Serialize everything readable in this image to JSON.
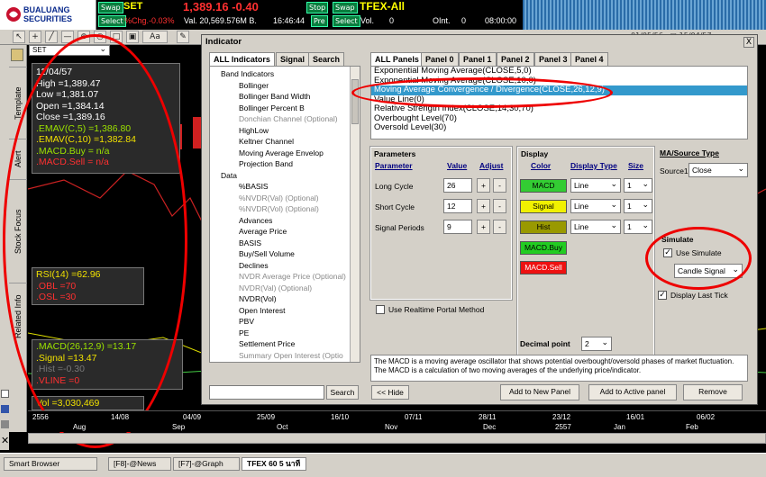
{
  "ticker": {
    "logo_line1": "BUALUANG",
    "logo_line2": "SECURITIES",
    "row1": {
      "swap": "Swap",
      "symbol": "SET",
      "price": "1,389.16 -0.40",
      "stop": "Stop",
      "swap2": "Swap",
      "tfex": "TFEX-All"
    },
    "row2": {
      "select": "Select",
      "chg": "%Chg.-0.03%",
      "val": "Val. 20,569.576M B.",
      "time": "16:46:44",
      "pre": "Pre",
      "select2": "Select",
      "vol": "Vol.",
      "vol_val": "0",
      "oint": "OInt.",
      "oint_val": "0",
      "time2": "08:00:00"
    }
  },
  "vtabs": [
    "Template",
    "Alert",
    "Stock Focus",
    "Related Info"
  ],
  "symbol_select": "SET",
  "info_panel": {
    "date": "11/04/57",
    "high": "High  =1,389.47",
    "low": "Low  =1,381.07",
    "open": "Open  =1,384.14",
    "close": "Close  =1,389.16",
    "emav5": ".EMAV(C,5)    =1,386.80",
    "emav10": ".EMAV(C,10)  =1,382.84",
    "macdbuy": ".MACD.Buy  = n/a",
    "macdsell": ".MACD.Sell  = n/a"
  },
  "rsi_panel": {
    "rsi": "RSI(14)   =62.96",
    "obl": ".OBL    =70",
    "osl": ".OSL    =30"
  },
  "macd_panel": {
    "macd": ".MACD(26,12,9)   =13.17",
    "signal": ".Signal  =13.47",
    "hist": ".Hist  =-0.30",
    "vline": ".VLINE   =0"
  },
  "vol_panel": {
    "vol": "Vol   =3,030,469"
  },
  "time_axis": {
    "row1": [
      "2556",
      "14/08",
      "04/09",
      "25/09",
      "16/10",
      "07/11",
      "28/11",
      "23/12",
      "16/01",
      "06/02"
    ],
    "row2": [
      "Aug",
      "Sep",
      "Oct",
      "Nov",
      "Dec",
      "2557",
      "Jan",
      "Feb"
    ]
  },
  "dialog": {
    "title": "Indicator",
    "left_tabs": [
      "ALL Indicators",
      "Signal",
      "Search"
    ],
    "tree": [
      {
        "label": "Band Indicators",
        "level": 0,
        "dim": false
      },
      {
        "label": "Bollinger",
        "level": 1,
        "dim": false
      },
      {
        "label": "Bollinger Band Width",
        "level": 1,
        "dim": false
      },
      {
        "label": "Bollinger Percent B",
        "level": 1,
        "dim": false
      },
      {
        "label": "Donchian Channel (Optional)",
        "level": 1,
        "dim": true
      },
      {
        "label": "HighLow",
        "level": 1,
        "dim": false
      },
      {
        "label": "Keltner Channel",
        "level": 1,
        "dim": false
      },
      {
        "label": "Moving Average Envelop",
        "level": 1,
        "dim": false
      },
      {
        "label": "Projection Band",
        "level": 1,
        "dim": false
      },
      {
        "label": "Data",
        "level": 0,
        "dim": false
      },
      {
        "label": "%BASIS",
        "level": 1,
        "dim": false
      },
      {
        "label": "%NVDR(Val) (Optional)",
        "level": 1,
        "dim": true
      },
      {
        "label": "%NVDR(Vol) (Optional)",
        "level": 1,
        "dim": true
      },
      {
        "label": "Advances",
        "level": 1,
        "dim": false
      },
      {
        "label": "Average Price",
        "level": 1,
        "dim": false
      },
      {
        "label": "BASIS",
        "level": 1,
        "dim": false
      },
      {
        "label": "Buy/Sell Volume",
        "level": 1,
        "dim": false
      },
      {
        "label": "Declines",
        "level": 1,
        "dim": false
      },
      {
        "label": "NVDR Average Price (Optional)",
        "level": 1,
        "dim": true
      },
      {
        "label": "NVDR(Val) (Optional)",
        "level": 1,
        "dim": true
      },
      {
        "label": "NVDR(Vol)",
        "level": 1,
        "dim": false
      },
      {
        "label": "Open Interest",
        "level": 1,
        "dim": false
      },
      {
        "label": "PBV",
        "level": 1,
        "dim": false
      },
      {
        "label": "PE",
        "level": 1,
        "dim": false
      },
      {
        "label": "Settlement Price",
        "level": 1,
        "dim": false
      },
      {
        "label": "Summary Open Interest (Optio",
        "level": 1,
        "dim": true
      }
    ],
    "search_button": "Search",
    "hide_button": "<< Hide",
    "panel_tabs": [
      "ALL Panels",
      "Panel 0",
      "Panel 1",
      "Panel 2",
      "Panel 3",
      "Panel 4"
    ],
    "panel_list": [
      "Exponential Moving Average(CLOSE,5,0)",
      "Exponential Moving Average(CLOSE,10,0)",
      "Moving Average Convergence / Divergence(CLOSE,26,12,9)",
      "Value Line(0)",
      "Relative Strength Index(CLOSE,14,30,70)",
      "Overbought Level(70)",
      "Oversold Level(30)"
    ],
    "selected_index": 2,
    "params": {
      "header": "Parameters",
      "col_param": "Parameter",
      "col_value": "Value",
      "col_adjust": "Adjust",
      "rows": [
        {
          "label": "Long Cycle",
          "value": "26"
        },
        {
          "label": "Short Cycle",
          "value": "12"
        },
        {
          "label": "Signal Periods",
          "value": "9"
        }
      ],
      "plus": "+",
      "minus": "-"
    },
    "display": {
      "header": "Display",
      "col_color": "Color",
      "col_type": "Display Type",
      "col_size": "Size",
      "rows": [
        {
          "name": "MACD",
          "color": "#33cc33",
          "type": "Line",
          "size": "1"
        },
        {
          "name": "Signal",
          "color": "#f0f000",
          "type": "Line",
          "size": "1"
        },
        {
          "name": "Hist",
          "color": "#999900",
          "type": "Line",
          "size": "1"
        }
      ],
      "buy_label": "MACD.Buy",
      "buy_color": "#22cc22",
      "sell_label": "MACD.Sell",
      "sell_color": "#ee1111"
    },
    "ma_source": {
      "header": "MA/Source Type",
      "label": "Source1",
      "value": "Close"
    },
    "simulate": {
      "header": "Simulate",
      "use_label": "Use Simulate",
      "use_checked": true,
      "mode": "Candle Signal"
    },
    "display_last_tick": "Display Last Tick",
    "realtime_label": "Use Realtime Portal Method",
    "decimal_label": "Decimal point",
    "decimal_value": "2",
    "description": "The MACD is a moving average oscillator that shows potential overbought/oversold phases of market fluctuation. The MACD is a calculation of two moving averages of the underlying price/indicator.",
    "add_new_panel": "Add to New Panel",
    "add_active_panel": "Add to Active panel",
    "remove": "Remove",
    "close": "X"
  },
  "taskbar": {
    "start": "Smart Browser",
    "tasks": [
      "[F8]-@News",
      "[F7]-@Graph",
      "TFEX 60 5 นาที"
    ]
  },
  "colors": {
    "accent_red": "#ee0000",
    "select_blue": "#3399cc"
  }
}
